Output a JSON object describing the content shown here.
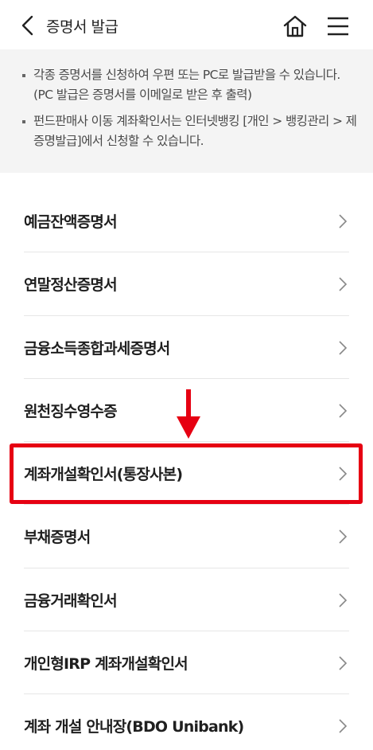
{
  "header": {
    "title": "증명서 발급"
  },
  "notice": {
    "items": [
      "각종 증명서를 신청하여 우편 또는 PC로 발급받을 수 있습니다.(PC 발급은 증명서를 이메일로 받은 후 출력)",
      "펀드판매사 이동 계좌확인서는 인터넷뱅킹 [개인 > 뱅킹관리 > 제증명발급]에서 신청할 수 있습니다."
    ]
  },
  "list": {
    "items": [
      "예금잔액증명서",
      "연말정산증명서",
      "금융소득종합과세증명서",
      "원천징수영수증",
      "계좌개설확인서(통장사본)",
      "부채증명서",
      "금융거래확인서",
      "개인형IRP 계좌개설확인서",
      "계좌 개설 안내장(BDO Unibank)"
    ]
  },
  "colors": {
    "highlight": "#e60012",
    "notice_bg": "#f4f4f4"
  },
  "icons": [
    "back-icon",
    "home-icon",
    "menu-icon",
    "chevron-right-icon",
    "down-arrow-icon"
  ]
}
